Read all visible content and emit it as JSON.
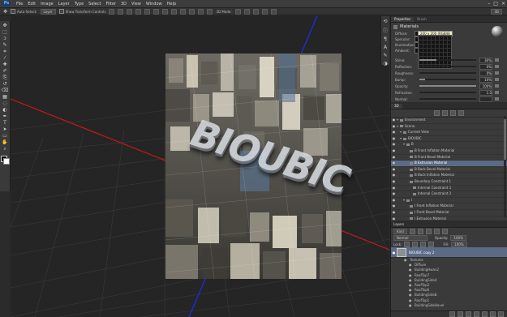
{
  "app": {
    "logo": "Ps"
  },
  "menu": [
    "File",
    "Edit",
    "Image",
    "Layer",
    "Type",
    "Select",
    "Filter",
    "3D",
    "View",
    "Window",
    "Help"
  ],
  "options": {
    "auto_select_label": "Auto-Select:",
    "auto_select_value": "Layer",
    "transform_label": "Show Transform Controls",
    "mode_label": "3D Mode:",
    "workspace": "3D"
  },
  "tools": [
    "move-tool",
    "marquee-tool",
    "lasso-tool",
    "quick-select-tool",
    "crop-tool",
    "eyedropper-tool",
    "healing-tool",
    "brush-tool",
    "clone-tool",
    "history-brush-tool",
    "eraser-tool",
    "gradient-tool",
    "blur-tool",
    "dodge-tool",
    "pen-tool",
    "type-tool",
    "path-select-tool",
    "shape-tool",
    "hand-tool",
    "zoom-tool"
  ],
  "tool_glyphs": [
    "✥",
    "⬚",
    "ↄ",
    "✎",
    "⌗",
    "⁄",
    "✚",
    "✐",
    "⎘",
    "↺",
    "⌫",
    "▦",
    "◌",
    "◐",
    "✒",
    "T",
    "➤",
    "▭",
    "✋",
    "⌕"
  ],
  "canvas": {
    "photo_text": "BIOUBIC"
  },
  "properties": {
    "tabs": [
      "Properties",
      "Brush"
    ],
    "title": "Materials",
    "rows": [
      "Diffuse:",
      "Specular:",
      "Illumination:",
      "Ambient:"
    ],
    "tooltip": "200 x 200 (RGB/8)",
    "sliders": [
      {
        "label": "Shine:",
        "value": "30%",
        "fill": 0.3
      },
      {
        "label": "Reflection:",
        "value": "0%",
        "fill": 0.0
      },
      {
        "label": "Roughness:",
        "value": "0%",
        "fill": 0.0
      },
      {
        "label": "Bump:",
        "value": "10%",
        "fill": 0.1
      },
      {
        "label": "Opacity:",
        "value": "100%",
        "fill": 1.0
      },
      {
        "label": "Refraction:",
        "value": "1.0",
        "fill": 0.0
      },
      {
        "label": "Normal:",
        "value": "",
        "fill": 0.0
      },
      {
        "label": "Environment:",
        "value": "",
        "fill": 0.0
      }
    ]
  },
  "scene": {
    "tab": "3D",
    "items": [
      {
        "label": "Environment",
        "indent": 0,
        "selected": false
      },
      {
        "label": "Scene",
        "indent": 0,
        "selected": false
      },
      {
        "label": "Current View",
        "indent": 1,
        "selected": false
      },
      {
        "label": "BIOUBIC",
        "indent": 1,
        "selected": false
      },
      {
        "label": "B",
        "indent": 2,
        "selected": false
      },
      {
        "label": "B Front Inflation Material",
        "indent": 3,
        "selected": false
      },
      {
        "label": "B Front Bevel Material",
        "indent": 3,
        "selected": false
      },
      {
        "label": "B Extrusion Material",
        "indent": 3,
        "selected": true
      },
      {
        "label": "B Back Bevel Material",
        "indent": 3,
        "selected": false
      },
      {
        "label": "B Back Inflation Material",
        "indent": 3,
        "selected": false
      },
      {
        "label": "Boundary Constraint 1",
        "indent": 3,
        "selected": false
      },
      {
        "label": "Internal Constraint 1",
        "indent": 4,
        "selected": false
      },
      {
        "label": "Internal Constraint 2",
        "indent": 4,
        "selected": false
      },
      {
        "label": "I",
        "indent": 2,
        "selected": false
      },
      {
        "label": "I Front Inflation Material",
        "indent": 3,
        "selected": false
      },
      {
        "label": "I Front Bevel Material",
        "indent": 3,
        "selected": false
      },
      {
        "label": "I Extrusion Material",
        "indent": 3,
        "selected": false
      },
      {
        "label": "I Back Bevel Material",
        "indent": 3,
        "selected": false
      },
      {
        "label": "I Back Inflation Material",
        "indent": 3,
        "selected": false
      }
    ]
  },
  "layers": {
    "tab": "Layers",
    "kind": "Kind",
    "blend": "Normal",
    "opacity_label": "Opacity:",
    "opacity": "100%",
    "lock_label": "Lock:",
    "fill_label": "Fill:",
    "fill": "100%",
    "main_layer": "BIOUBIC copy 2",
    "sublayers": [
      "Textures",
      "Diffuse",
      "BuildingHwan2",
      "RoofTop7",
      "BuildingSide4",
      "RoofTop2",
      "RoofTop6",
      "BuildingSide8",
      "RoofTop1",
      "BuildingSideHovel"
    ]
  }
}
